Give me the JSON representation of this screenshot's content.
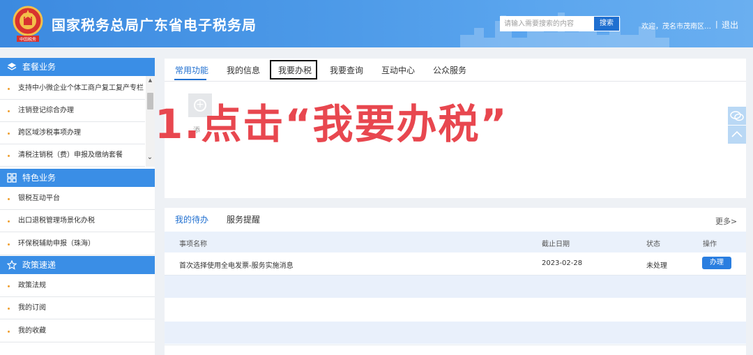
{
  "header": {
    "site_title": "国家税务总局广东省电子税务局",
    "search_placeholder": "请输入需要搜索的内容",
    "search_button": "搜索",
    "welcome_text": "欢迎，茂名市茂南区…",
    "separator": "|",
    "logout": "退出",
    "emblem_text": "中国税务",
    "brand_color": "#3c8ae0"
  },
  "sidebar": {
    "sections": [
      {
        "title": "套餐业务",
        "icon": "layers-icon",
        "items": [
          "支持中小微企业个体工商户复工复产专栏",
          "注销登记综合办理",
          "跨区域涉税事项办理",
          "清税注销税（费）申报及缴纳套餐"
        ]
      },
      {
        "title": "特色业务",
        "icon": "grid-icon",
        "items": [
          "银税互动平台",
          "出口退税管理场景化办税",
          "环保税辅助申报（珠海）"
        ]
      },
      {
        "title": "政策速递",
        "icon": "star-icon",
        "items": [
          "政策法规",
          "我的订阅",
          "我的收藏"
        ]
      }
    ]
  },
  "top_panel": {
    "tabs": [
      "常用功能",
      "我的信息",
      "我要办税",
      "我要查询",
      "互动中心",
      "公众服务"
    ],
    "active_tab": "常用功能",
    "highlighted_tab": "我要办税",
    "add_tile_label": "添"
  },
  "annotation": {
    "text": "1.点击“我要办税”",
    "color": "#e8474f"
  },
  "bottom_panel": {
    "tabs": [
      "我的待办",
      "服务提醒"
    ],
    "active_tab": "我的待办",
    "more": "更多>",
    "columns": [
      "事项名称",
      "截止日期",
      "状态",
      "操作"
    ],
    "rows": [
      {
        "name": "首次选择使用全电发票-服务实施消息",
        "deadline": "2023-02-28",
        "status": "未处理",
        "action": "办理"
      }
    ]
  }
}
